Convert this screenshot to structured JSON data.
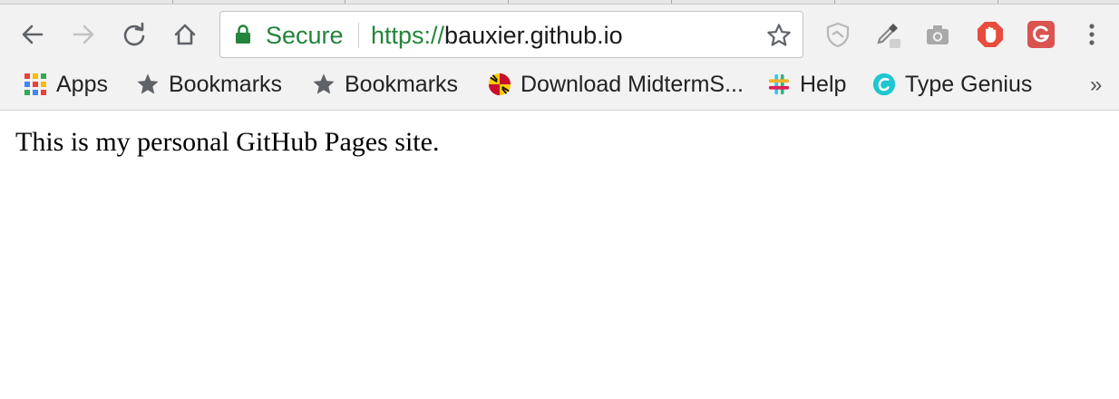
{
  "toolbar": {
    "back_icon": "back-arrow-icon",
    "forward_icon": "forward-arrow-icon",
    "reload_icon": "reload-icon",
    "home_icon": "home-icon"
  },
  "omnibox": {
    "security_label": "Secure",
    "url_scheme": "https://",
    "url_host": "bauxier.github.io",
    "lock_color": "#23843a",
    "bookmark_star_icon": "star-outline-icon"
  },
  "extensions": [
    {
      "name": "shield-extension-icon"
    },
    {
      "name": "eyedropper-extension-icon"
    },
    {
      "name": "camera-extension-icon"
    },
    {
      "name": "adblock-hand-extension-icon"
    },
    {
      "name": "grammarly-extension-icon"
    }
  ],
  "bookmarks": [
    {
      "label": "Apps",
      "icon": "apps-grid-icon"
    },
    {
      "label": "Bookmarks",
      "icon": "star-icon"
    },
    {
      "label": "Bookmarks",
      "icon": "star-icon"
    },
    {
      "label": "Download MidtermS...",
      "icon": "maryland-flag-icon"
    },
    {
      "label": "Help",
      "icon": "slack-icon"
    },
    {
      "label": "Type Genius",
      "icon": "type-genius-icon"
    }
  ],
  "overflow_label": "»",
  "page": {
    "text": "This is my personal GitHub Pages site."
  },
  "colors": {
    "accent_green": "#23843a",
    "adblock_red": "#e74c3c",
    "grammarly_red": "#d9534f",
    "type_genius_teal": "#1ec6d0"
  }
}
